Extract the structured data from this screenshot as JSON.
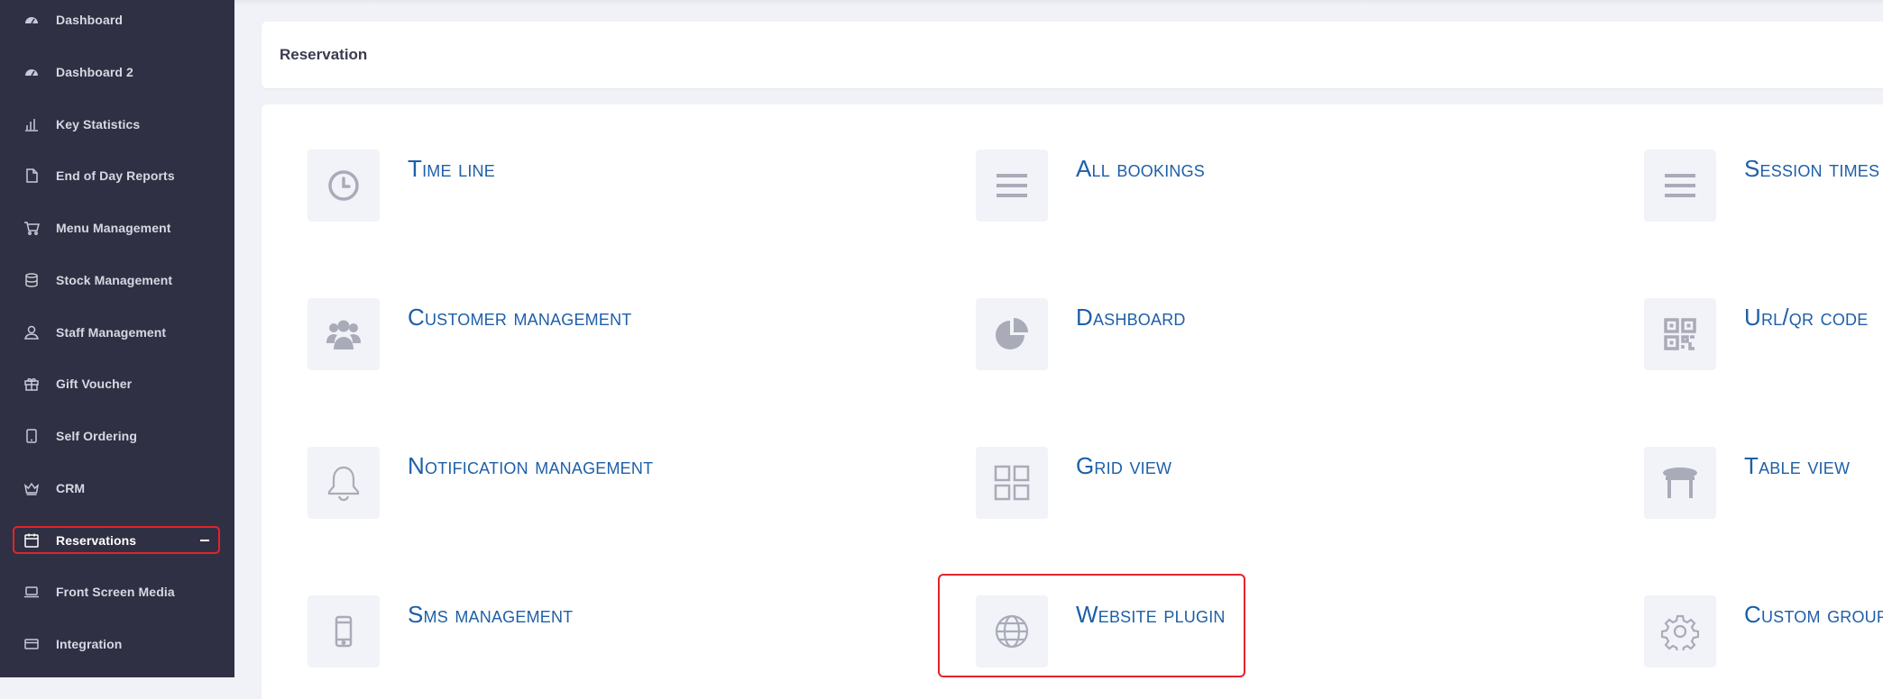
{
  "sidebar": {
    "items": [
      {
        "label": "Dashboard",
        "icon": "speedometer-icon"
      },
      {
        "label": "Dashboard 2",
        "icon": "speedometer-icon"
      },
      {
        "label": "Key Statistics",
        "icon": "bar-chart-icon"
      },
      {
        "label": "End of Day Reports",
        "icon": "document-icon"
      },
      {
        "label": "Menu Management",
        "icon": "cart-icon"
      },
      {
        "label": "Stock Management",
        "icon": "database-icon"
      },
      {
        "label": "Staff Management",
        "icon": "user-icon"
      },
      {
        "label": "Gift Voucher",
        "icon": "gift-icon"
      },
      {
        "label": "Self Ordering",
        "icon": "tablet-icon"
      },
      {
        "label": "CRM",
        "icon": "crown-icon"
      },
      {
        "label": "Reservations",
        "icon": "calendar-icon",
        "active": true
      },
      {
        "label": "Front Screen Media",
        "icon": "laptop-icon"
      },
      {
        "label": "Integration",
        "icon": "card-icon"
      }
    ]
  },
  "page": {
    "title": "Reservation"
  },
  "tiles": [
    {
      "label": "Time line",
      "icon": "clock-icon"
    },
    {
      "label": "All bookings",
      "icon": "list-icon"
    },
    {
      "label": "Session times",
      "icon": "list-icon"
    },
    {
      "label": "Customer management",
      "icon": "users-group-icon"
    },
    {
      "label": "Dashboard",
      "icon": "pie-chart-icon"
    },
    {
      "label": "Url/qr code",
      "icon": "qr-code-icon"
    },
    {
      "label": "Notification management",
      "icon": "bell-icon"
    },
    {
      "label": "Grid view",
      "icon": "grid-icon"
    },
    {
      "label": "Table view",
      "icon": "table-icon"
    },
    {
      "label": "Sms management",
      "icon": "mobile-phone-icon"
    },
    {
      "label": "Website plugin",
      "icon": "globe-icon"
    },
    {
      "label": "Custom group",
      "icon": "gear-icon"
    }
  ],
  "colors": {
    "sidebar_bg": "#2f3043",
    "accent_link": "#1e5fa8",
    "highlight_red": "#e3232a",
    "icon_gray": "#a9abb8"
  }
}
